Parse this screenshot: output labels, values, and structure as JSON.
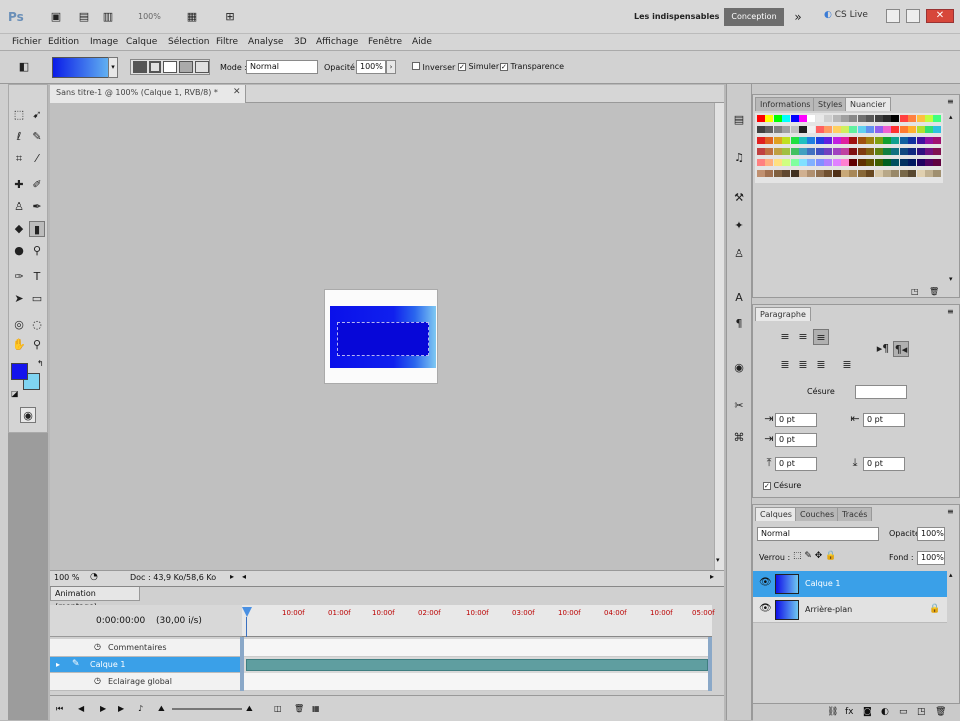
{
  "app": {
    "logo": "Ps",
    "workspace_label": "Les indispensables",
    "workspace_active": "Conception",
    "cslive": "CS Live",
    "zoom": "100%"
  },
  "menu": [
    "Fichier",
    "Edition",
    "Image",
    "Calque",
    "Sélection",
    "Filtre",
    "Analyse",
    "3D",
    "Affichage",
    "Fenêtre",
    "Aide"
  ],
  "options": {
    "mode_label": "Mode :",
    "mode_value": "Normal",
    "opacity_label": "Opacité :",
    "opacity_value": "100%",
    "inverse_label": "Inverser",
    "simulation_label": "Simuler",
    "transparency_label": "Transparence"
  },
  "document": {
    "tab_title": "Sans titre-1 @ 100% (Calque 1, RVB/8) *",
    "status_zoom": "100 %",
    "status_doc": "Doc : 43,9 Ko/58,6 Ko"
  },
  "animation": {
    "panel_title": "Animation (montage)",
    "timecode": "0:00:00:00",
    "fps": "(30,00 i/s)",
    "ruler_labels": [
      "10:00f",
      "01:00f",
      "10:00f",
      "02:00f",
      "10:00f",
      "03:00f",
      "10:00f",
      "04:00f",
      "10:00f",
      "05:00f"
    ],
    "rows": [
      {
        "label": "Commentaires"
      },
      {
        "label": "Calque 1"
      },
      {
        "label": "Eclairage global"
      }
    ]
  },
  "panels": {
    "swatch_tabs": [
      "Informations",
      "Styles",
      "Nuancier"
    ],
    "paragraph_title": "Paragraphe",
    "hyphen_label": "Césure",
    "hyphen_checkbox": "Césure",
    "spacing_values": [
      "0 pt",
      "0 pt",
      "0 pt",
      "0 pt",
      "0 pt"
    ],
    "layer_tabs": [
      "Calques",
      "Couches",
      "Tracés"
    ],
    "blend_mode": "Normal",
    "opacity_label": "Opacité :",
    "opacity_value": "100%",
    "lock_label": "Verrou :",
    "fill_label": "Fond :",
    "fill_value": "100%",
    "layers": [
      {
        "name": "Calque 1",
        "selected": true
      },
      {
        "name": "Arrière-plan",
        "selected": false
      }
    ]
  },
  "colors": {
    "foreground": "#1414ee",
    "background": "#7fd4f2",
    "selection": "#3aa0e8"
  }
}
